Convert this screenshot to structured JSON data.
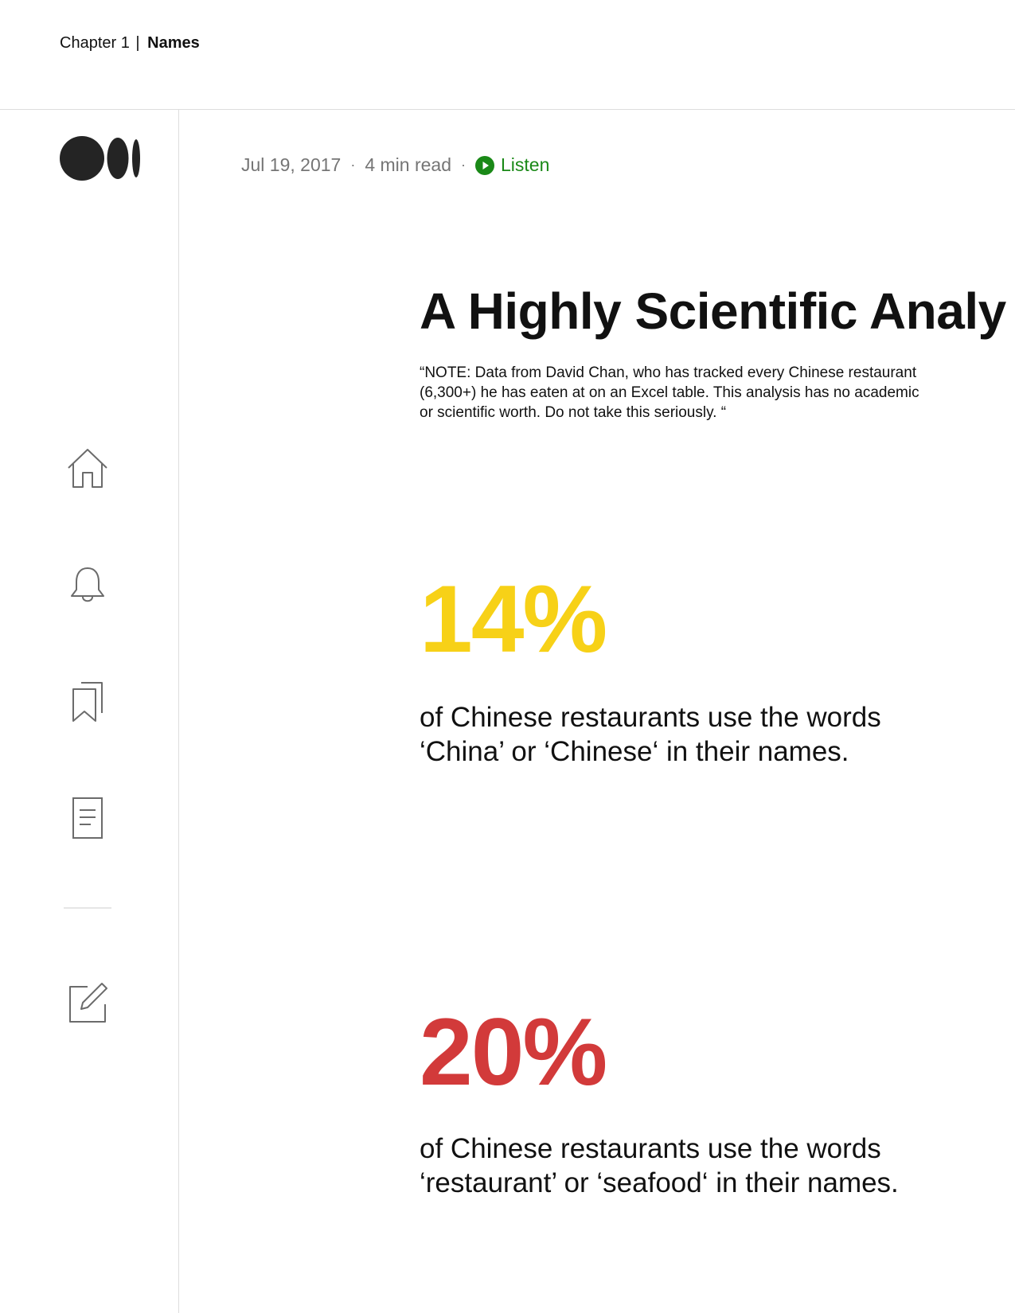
{
  "header": {
    "chapter_label": "Chapter 1",
    "separator": "|",
    "chapter_title": "Names"
  },
  "sidebar": {
    "logo": "medium-logo",
    "items": [
      {
        "icon": "home-icon"
      },
      {
        "icon": "bell-icon"
      },
      {
        "icon": "bookmarks-icon"
      },
      {
        "icon": "document-icon"
      },
      {
        "icon": "write-icon"
      }
    ]
  },
  "article": {
    "date": "Jul 19, 2017",
    "read_time": "4 min read",
    "dot": "·",
    "listen_label": "Listen",
    "title": "A Highly Scientific Analy",
    "note": "“NOTE: Data from David Chan, who has tracked every Chinese restaurant (6,300+) he has eaten at on an Excel table. This analysis has no academic or scientific worth. Do not take this seriously. “",
    "stats": [
      {
        "value": "14%",
        "text": "of Chinese restaurants use the words ‘China’ or ‘Chinese‘ in their names.",
        "color": "#f7d117"
      },
      {
        "value": "20%",
        "text": "of Chinese restaurants use the words ‘restaurant’ or ‘seafood‘ in their names.",
        "color": "#d23a3a"
      }
    ]
  },
  "colors": {
    "accent_green": "#1a8917",
    "icon_gray": "#6b6b6b",
    "divider": "#dddddd"
  }
}
